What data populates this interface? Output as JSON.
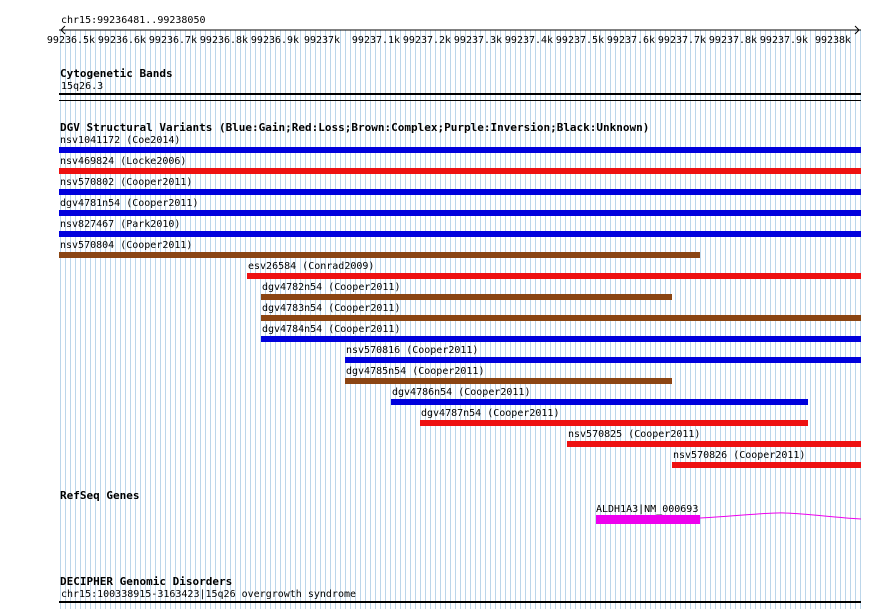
{
  "ruler": {
    "coords": "chr15:99236481..99238050",
    "ticks": [
      "99236.5k",
      "99236.6k",
      "99236.7k",
      "99236.8k",
      "99236.9k",
      "99237k",
      "99237.1k",
      "99237.2k",
      "99237.3k",
      "99237.4k",
      "99237.5k",
      "99237.6k",
      "99237.7k",
      "99237.8k",
      "99237.9k",
      "99238k"
    ]
  },
  "cytoband": {
    "title": "Cytogenetic Bands",
    "band": "15q26.3"
  },
  "dgv": {
    "title": "DGV Structural Variants (Blue:Gain;Red:Loss;Brown:Complex;Purple:Inversion;Black:Unknown)",
    "colors": {
      "gain": "#0000dd",
      "loss": "#ee1111",
      "complex": "#8b4513"
    },
    "variants": [
      {
        "label": "nsv1041172 (Coe2014)",
        "type": "gain"
      },
      {
        "label": "nsv469824 (Locke2006)",
        "type": "loss"
      },
      {
        "label": "nsv570802 (Cooper2011)",
        "type": "gain"
      },
      {
        "label": "dgv4781n54 (Cooper2011)",
        "type": "gain"
      },
      {
        "label": "nsv827467 (Park2010)",
        "type": "gain"
      },
      {
        "label": "nsv570804 (Cooper2011)",
        "type": "complex"
      },
      {
        "label": "esv26584 (Conrad2009)",
        "type": "loss"
      },
      {
        "label": "dgv4782n54 (Cooper2011)",
        "type": "complex"
      },
      {
        "label": "dgv4783n54 (Cooper2011)",
        "type": "complex"
      },
      {
        "label": "dgv4784n54 (Cooper2011)",
        "type": "gain"
      },
      {
        "label": "nsv570816 (Cooper2011)",
        "type": "gain"
      },
      {
        "label": "dgv4785n54 (Cooper2011)",
        "type": "complex"
      },
      {
        "label": "dgv4786n54 (Cooper2011)",
        "type": "gain"
      },
      {
        "label": "dgv4787n54 (Cooper2011)",
        "type": "loss"
      },
      {
        "label": "nsv570825 (Cooper2011)",
        "type": "loss"
      },
      {
        "label": "nsv570826 (Cooper2011)",
        "type": "loss"
      }
    ]
  },
  "refseq": {
    "title": "RefSeq Genes",
    "gene": "ALDH1A3|NM_000693",
    "color": "#ee00ee"
  },
  "decipher": {
    "title": "DECIPHER Genomic Disorders",
    "entry": "chr15:100338915-3163423|15q26 overgrowth syndrome"
  }
}
